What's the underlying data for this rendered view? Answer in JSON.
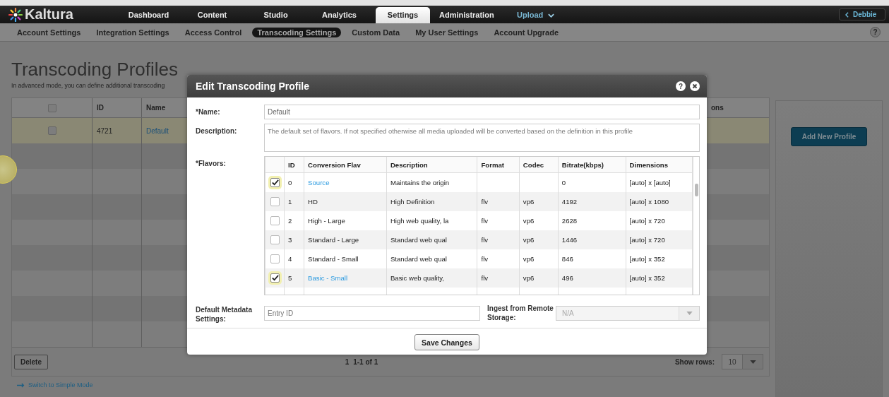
{
  "top_nav": {
    "logo": "Kaltura",
    "tabs": [
      {
        "label": "Dashboard",
        "selected": false
      },
      {
        "label": "Content",
        "selected": false
      },
      {
        "label": "Studio",
        "selected": false
      },
      {
        "label": "Analytics",
        "selected": false
      },
      {
        "label": "Settings",
        "selected": true
      },
      {
        "label": "Administration",
        "selected": false
      }
    ],
    "upload": "Upload",
    "user": "Debbie"
  },
  "sub_nav": {
    "items": [
      {
        "label": "Account Settings",
        "selected": false
      },
      {
        "label": "Integration Settings",
        "selected": false
      },
      {
        "label": "Access Control",
        "selected": false
      },
      {
        "label": "Transcoding Settings",
        "selected": true
      },
      {
        "label": "Custom Data",
        "selected": false
      },
      {
        "label": "My User Settings",
        "selected": false
      },
      {
        "label": "Account Upgrade",
        "selected": false
      }
    ],
    "help": "?"
  },
  "page": {
    "title": "Transcoding Profiles",
    "subtitle": "In advanced mode, you can define additional transcoding",
    "table": {
      "header_checked": false,
      "columns": [
        "ID",
        "Name",
        "ons"
      ],
      "rows": [
        {
          "checked": false,
          "selected": true,
          "id": "4721",
          "name": "Default"
        }
      ]
    },
    "delete": "Delete",
    "page_number": "1",
    "range": "1-1 of 1",
    "show_rows_label": "Show rows:",
    "show_rows_value": "10",
    "switch_link": "Switch to Simple Mode",
    "add_button": "Add New Profile"
  },
  "modal": {
    "title": "Edit Transcoding Profile",
    "help": "?",
    "name_label": "*Name:",
    "name_value": "Default",
    "description_label": "Description:",
    "description_value": "The default set of flavors. If not specified otherwise all media uploaded will be converted based on the definition in this profile",
    "flavors_label": "*Flavors:",
    "flavor_columns": [
      "ID",
      "Conversion Flav",
      "Description",
      "Format",
      "Codec",
      "Bitrate(kbps)",
      "Dimensions"
    ],
    "flavors": [
      {
        "checked": true,
        "id": "0",
        "name": "Source",
        "description": "Maintains the origin",
        "bitrate": "0",
        "dimensions": "[auto] x [auto]"
      },
      {
        "checked": false,
        "id": "1",
        "name": "HD",
        "description": "High Definition",
        "format": "flv",
        "codec": "vp6",
        "bitrate": "4192",
        "dimensions": "[auto] x 1080"
      },
      {
        "checked": false,
        "id": "2",
        "name": "High - Large",
        "description": "High web quality, la",
        "format": "flv",
        "codec": "vp6",
        "bitrate": "2628",
        "dimensions": "[auto] x 720"
      },
      {
        "checked": false,
        "id": "3",
        "name": "Standard - Large",
        "description": "Standard web qual",
        "format": "flv",
        "codec": "vp6",
        "bitrate": "1446",
        "dimensions": "[auto] x 720"
      },
      {
        "checked": false,
        "id": "4",
        "name": "Standard - Small",
        "description": "Standard web qual",
        "format": "flv",
        "codec": "vp6",
        "bitrate": "846",
        "dimensions": "[auto] x 352"
      },
      {
        "checked": true,
        "id": "5",
        "name": "Basic - Small",
        "description": "Basic web quality,",
        "format": "flv",
        "codec": "vp6",
        "bitrate": "496",
        "dimensions": "[auto] x 352"
      }
    ],
    "metadata_label": "Default Metadata Settings:",
    "metadata_placeholder": "Entry ID",
    "ingest_label": "Ingest from Remote Storage:",
    "ingest_value": "N/A",
    "ingest_disabled": true,
    "save": "Save Changes"
  }
}
